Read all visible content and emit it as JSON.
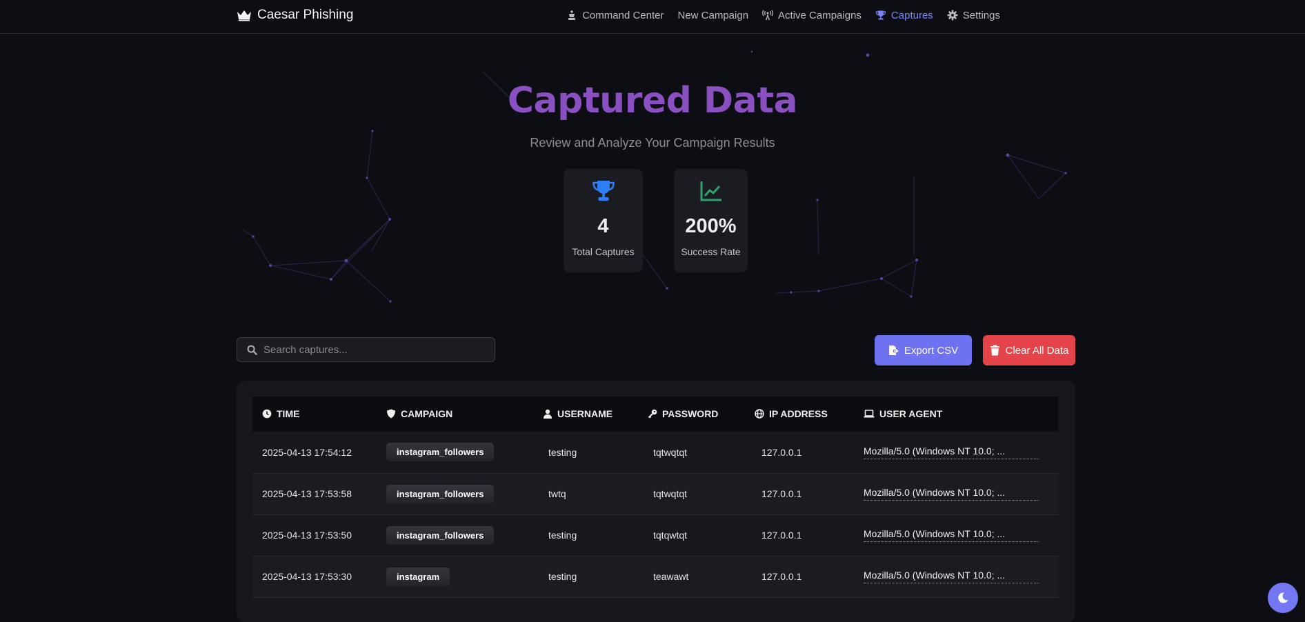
{
  "brand": {
    "name": "Caesar Phishing",
    "icon": "crown-icon"
  },
  "nav": [
    {
      "label": "Command Center",
      "icon": "chess-king-icon",
      "active": false
    },
    {
      "label": "New Campaign",
      "icon": "",
      "active": false
    },
    {
      "label": "Active Campaigns",
      "icon": "broadcast-tower-icon",
      "active": false
    },
    {
      "label": "Captures",
      "icon": "trophy-icon",
      "active": true
    },
    {
      "label": "Settings",
      "icon": "gear-icon",
      "active": false
    }
  ],
  "hero": {
    "title": "Captured Data",
    "subtitle": "Review and Analyze Your Campaign Results"
  },
  "stats": [
    {
      "value": "4",
      "label": "Total Captures",
      "icon": "trophy-icon",
      "color": "#2e7ef5"
    },
    {
      "value": "200%",
      "label": "Success Rate",
      "icon": "chart-line-icon",
      "color": "#2fa36b"
    }
  ],
  "search": {
    "placeholder": "Search captures...",
    "value": ""
  },
  "actions": {
    "export_label": "Export CSV",
    "clear_label": "Clear All Data"
  },
  "table": {
    "columns": [
      {
        "label": "TIME",
        "icon": "clock-icon"
      },
      {
        "label": "CAMPAIGN",
        "icon": "shield-icon"
      },
      {
        "label": "USERNAME",
        "icon": "user-icon"
      },
      {
        "label": "PASSWORD",
        "icon": "key-icon"
      },
      {
        "label": "IP ADDRESS",
        "icon": "globe-icon"
      },
      {
        "label": "USER AGENT",
        "icon": "laptop-icon"
      }
    ],
    "rows": [
      {
        "time": "2025-04-13 17:54:12",
        "campaign": "instagram_followers",
        "username": "testing",
        "password": "tqtwqtqt",
        "ip": "127.0.0.1",
        "user_agent": "Mozilla/5.0 (Windows NT 10.0; ..."
      },
      {
        "time": "2025-04-13 17:53:58",
        "campaign": "instagram_followers",
        "username": "twtq",
        "password": "tqtwqtqt",
        "ip": "127.0.0.1",
        "user_agent": "Mozilla/5.0 (Windows NT 10.0; ..."
      },
      {
        "time": "2025-04-13 17:53:50",
        "campaign": "instagram_followers",
        "username": "testing",
        "password": "tqtqwtqt",
        "ip": "127.0.0.1",
        "user_agent": "Mozilla/5.0 (Windows NT 10.0; ..."
      },
      {
        "time": "2025-04-13 17:53:30",
        "campaign": "instagram",
        "username": "testing",
        "password": "teawawt",
        "ip": "127.0.0.1",
        "user_agent": "Mozilla/5.0 (Windows NT 10.0; ..."
      }
    ]
  },
  "theme_toggle": {
    "icon": "moon-icon"
  },
  "colors": {
    "accent": "#7b84f7",
    "title": "#8a4fc0",
    "export": "#6f72f0",
    "danger": "#e5434a",
    "background": "#0d0e13"
  }
}
